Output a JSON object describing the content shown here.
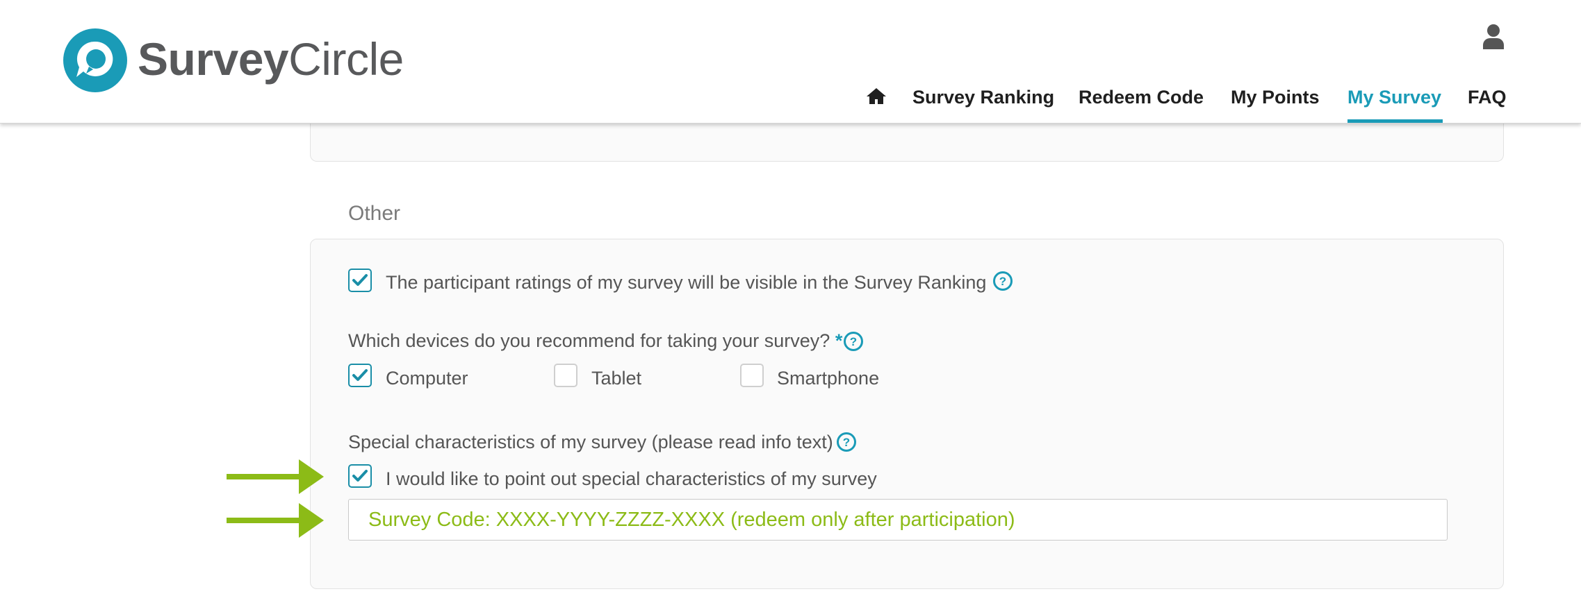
{
  "header": {
    "logo": {
      "word1": "Survey",
      "word2": "Circle"
    },
    "user_icon": "user-icon",
    "nav": {
      "home_icon": "home-icon",
      "items": [
        {
          "label": "Survey Ranking"
        },
        {
          "label": "Redeem Code"
        },
        {
          "label": "My Points"
        },
        {
          "label": "My Survey",
          "active": true
        },
        {
          "label": "FAQ"
        }
      ]
    }
  },
  "colors": {
    "accent": "#1a9bb7",
    "highlight_green": "#8cbb17",
    "text": "#555555"
  },
  "section": {
    "title": "Other",
    "ranking_visible": {
      "checked": true,
      "label": "The participant ratings of my survey will be visible in the Survey Ranking"
    },
    "devices": {
      "question": "Which devices do you recommend for taking your survey?",
      "required_mark": "*",
      "options": [
        {
          "label": "Computer",
          "checked": true
        },
        {
          "label": "Tablet",
          "checked": false
        },
        {
          "label": "Smartphone",
          "checked": false
        }
      ]
    },
    "special": {
      "question": "Special characteristics of my survey (please read info text)",
      "checkbox": {
        "checked": true,
        "label": "I would like to point out special characteristics of my survey"
      },
      "input_value": "Survey Code: XXXX-YYYY-ZZZZ-XXXX (redeem only after participation)"
    },
    "help_icon": "question-circle-icon",
    "pointer_icon": "green-arrow-icon"
  }
}
